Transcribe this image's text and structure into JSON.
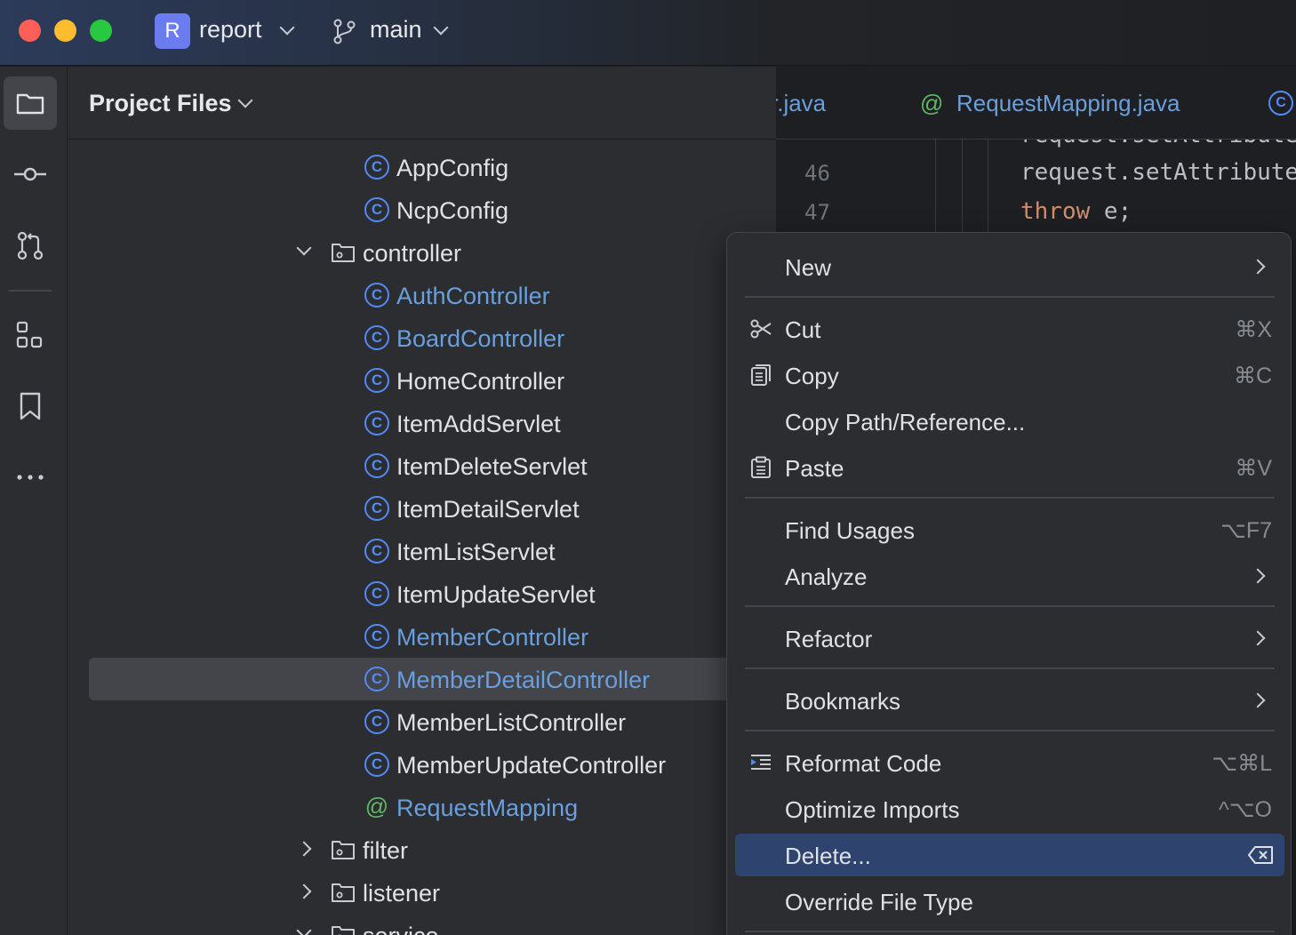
{
  "titlebar": {
    "project_initial": "R",
    "project_name": "report",
    "branch_name": "main"
  },
  "toolstrip": {
    "items": [
      {
        "icon": "folder-icon",
        "active": true
      },
      {
        "icon": "commit-icon"
      },
      {
        "icon": "pull-request-icon"
      },
      {
        "icon": "structure-icon"
      },
      {
        "icon": "bookmark-icon"
      },
      {
        "icon": "more-icon"
      }
    ]
  },
  "project_panel": {
    "title": "Project Files",
    "tree": [
      {
        "label": "AppConfig",
        "kind": "class",
        "style": "plain"
      },
      {
        "label": "NcpConfig",
        "kind": "class",
        "style": "plain"
      },
      {
        "label": "controller",
        "kind": "folder",
        "expanded": true
      },
      {
        "label": "AuthController",
        "kind": "class",
        "style": "link"
      },
      {
        "label": "BoardController",
        "kind": "class",
        "style": "link"
      },
      {
        "label": "HomeController",
        "kind": "class",
        "style": "plain"
      },
      {
        "label": "ItemAddServlet",
        "kind": "class",
        "style": "plain"
      },
      {
        "label": "ItemDeleteServlet",
        "kind": "class",
        "style": "plain"
      },
      {
        "label": "ItemDetailServlet",
        "kind": "class",
        "style": "plain"
      },
      {
        "label": "ItemListServlet",
        "kind": "class",
        "style": "plain"
      },
      {
        "label": "ItemUpdateServlet",
        "kind": "class",
        "style": "plain"
      },
      {
        "label": "MemberController",
        "kind": "class",
        "style": "link"
      },
      {
        "label": "MemberDetailController",
        "kind": "class",
        "style": "link",
        "selected": true
      },
      {
        "label": "MemberListController",
        "kind": "class",
        "style": "plain"
      },
      {
        "label": "MemberUpdateController",
        "kind": "class",
        "style": "plain"
      },
      {
        "label": "RequestMapping",
        "kind": "annotation",
        "style": "link"
      },
      {
        "label": "filter",
        "kind": "folder",
        "expanded": false
      },
      {
        "label": "listener",
        "kind": "folder",
        "expanded": false
      },
      {
        "label": "service",
        "kind": "folder",
        "expanded": true
      }
    ]
  },
  "editor": {
    "tabs": [
      {
        "label": "r.java"
      },
      {
        "label": "RequestMapping.java"
      }
    ],
    "lines": [
      {
        "no": "46",
        "code": "request.setAttribute("
      },
      {
        "no": "47",
        "keyword": "throw",
        "code": " e;"
      }
    ]
  },
  "context_menu": {
    "items": [
      {
        "label": "New",
        "submenu": true
      },
      {
        "label": "Cut",
        "shortcut": "⌘X",
        "icon": "scissors-icon"
      },
      {
        "label": "Copy",
        "shortcut": "⌘C",
        "icon": "copy-icon"
      },
      {
        "label": "Copy Path/Reference..."
      },
      {
        "label": "Paste",
        "shortcut": "⌘V",
        "icon": "clipboard-icon"
      },
      {
        "label": "Find Usages",
        "shortcut": "⌥F7"
      },
      {
        "label": "Analyze",
        "submenu": true
      },
      {
        "label": "Refactor",
        "submenu": true
      },
      {
        "label": "Bookmarks",
        "submenu": true
      },
      {
        "label": "Reformat Code",
        "shortcut": "⌥⌘L",
        "icon": "reformat-icon"
      },
      {
        "label": "Optimize Imports",
        "shortcut": "^⌥O"
      },
      {
        "label": "Delete...",
        "highlighted": true,
        "shortcut_icon": "delete-key-icon"
      },
      {
        "label": "Override File Type"
      }
    ]
  },
  "colors": {
    "accent_link": "#6a9fdc",
    "class_icon": "#548af7",
    "annotation_icon": "#5fb865",
    "menu_highlight": "#2e436e",
    "keyword": "#cf8e6d"
  }
}
